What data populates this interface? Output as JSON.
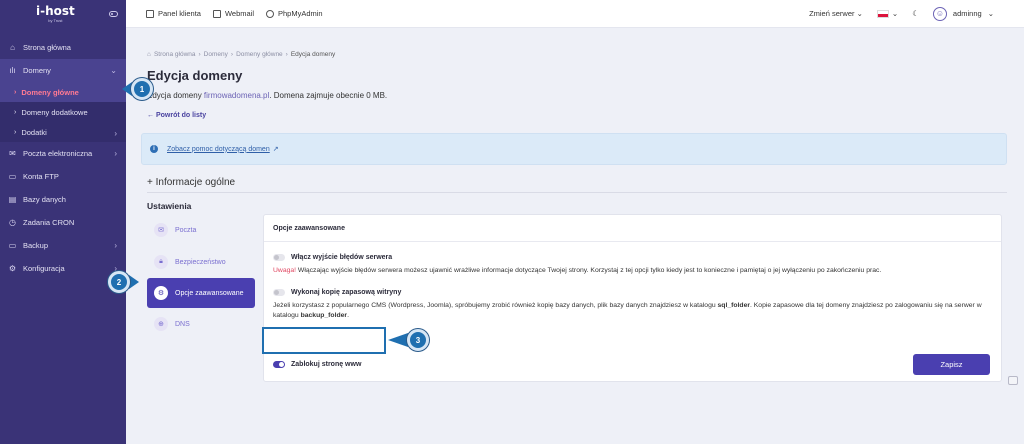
{
  "brand": {
    "logo": "i-host",
    "tagline": "by Trust"
  },
  "sidebar": {
    "items": [
      {
        "label": "Strona główna",
        "icon": "home-icon"
      },
      {
        "label": "Domeny",
        "icon": "domains-icon",
        "active": true
      },
      {
        "label": "Domeny główne",
        "sub": true,
        "current": true
      },
      {
        "label": "Domeny dodatkowe",
        "sub": true
      },
      {
        "label": "Dodatki",
        "sub": true,
        "chevron": true
      },
      {
        "label": "Poczta elektroniczna",
        "icon": "mail-icon",
        "chevron": true
      },
      {
        "label": "Konta FTP",
        "icon": "ftp-icon"
      },
      {
        "label": "Bazy danych",
        "icon": "database-icon"
      },
      {
        "label": "Zadania CRON",
        "icon": "clock-icon"
      },
      {
        "label": "Backup",
        "icon": "backup-icon",
        "chevron": true
      },
      {
        "label": "Konfiguracja",
        "icon": "gear-icon",
        "chevron": true
      }
    ]
  },
  "topbar": {
    "links": [
      "Panel klienta",
      "Webmail",
      "PhpMyAdmin"
    ],
    "server_switch": "Zmień serwer",
    "user": "adminng"
  },
  "breadcrumb": [
    "Strona główna",
    "Domeny",
    "Domeny główne",
    "Edycja domeny"
  ],
  "page": {
    "title": "Edycja domeny",
    "desc_prefix": "Edycja domeny ",
    "domain": "firmowadomena.pl",
    "desc_suffix": ". Domena zajmuje obecnie 0 MB.",
    "back": "Powrót do listy",
    "help_link": "Zobacz pomoc dotyczącą domen",
    "section": "+ Informacje ogólne",
    "settings": "Ustawienia"
  },
  "settings_nav": [
    {
      "label": "Poczta",
      "icon": "mail-icon"
    },
    {
      "label": "Bezpieczeństwo",
      "icon": "lock-icon"
    },
    {
      "label": "Opcje zaawansowane",
      "icon": "gear-icon",
      "active": true
    },
    {
      "label": "DNS",
      "icon": "globe-icon"
    }
  ],
  "card": {
    "title": "Opcje zaawansowane",
    "opt1_label": "Włącz wyjście błędów serwera",
    "opt1_warn": "Uwaga!",
    "opt1_text": " Włączając wyjście błędów serwera możesz ujawnić wrażliwe informacje dotyczące Twojej strony. Korzystaj z tej opcji tylko kiedy jest to konieczne i pamiętaj o jej wyłączeniu po zakończeniu prac.",
    "opt2_label": "Wykonaj kopię zapasową witryny",
    "opt2_text1": "Jeżeli korzystasz z popularnego CMS (Wordpress, Joomla), spróbujemy zrobić również kopię bazy danych, plik bazy danych znajdziesz w katalogu ",
    "opt2_sql": "sql_folder",
    "opt2_text2": ". Kopie zapasowe dla tej domeny znajdziesz po zalogowaniu się na serwer w katalogu ",
    "opt2_backup": "backup_folder",
    "opt2_text3": ".",
    "opt3_label": "Zablokuj stronę www",
    "save": "Zapisz"
  },
  "markers": [
    "1",
    "2",
    "3"
  ],
  "colors": {
    "sidebar": "#3a3377",
    "accent": "#4a3fb0",
    "marker": "#1f6fb0",
    "warn": "#e0455f"
  }
}
